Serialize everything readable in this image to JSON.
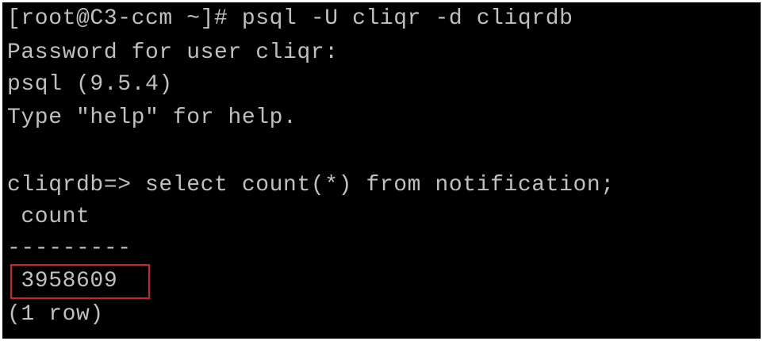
{
  "terminal": {
    "lines": {
      "l1": "[root@C3-ccm ~]# psql -U cliqr -d cliqrdb",
      "l2": "Password for user cliqr:",
      "l3": "psql (9.5.4)",
      "l4": "Type \"help\" for help.",
      "l5": "",
      "l6": "cliqrdb=> select count(*) from notification;",
      "l7": " count",
      "l8": "---------",
      "l9": " 3958609",
      "l10": "(1 row)"
    },
    "colors": {
      "background": "#000000",
      "text": "#c0c0c0",
      "highlight_border": "#d32020"
    }
  }
}
